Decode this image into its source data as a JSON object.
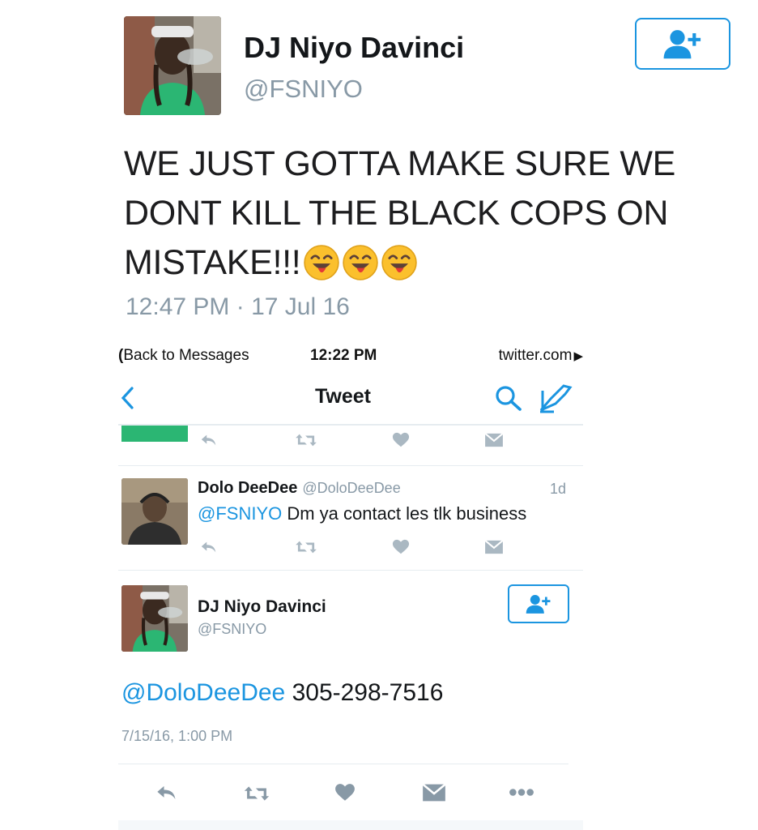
{
  "main_tweet": {
    "name": "DJ Niyo Davinci",
    "handle": "@FSNIYO",
    "text": "WE JUST GOTTA MAKE SURE WE DONT KILL THE BLACK COPS ON MISTAKE!!!",
    "emoji": "winking-face-with-tongue",
    "emoji_count": 3,
    "timestamp": "12:47 PM · 17 Jul 16"
  },
  "status_bar": {
    "back": "Back to Messages",
    "time": "12:22 PM",
    "site": "twitter.com"
  },
  "nav": {
    "title": "Tweet"
  },
  "reply": {
    "name": "Dolo DeeDee",
    "handle": "@DoloDeeDee",
    "time": "1d",
    "mention": "@FSNIYO",
    "text": "Dm ya contact les tlk business"
  },
  "detail_tweet": {
    "name": "DJ Niyo Davinci",
    "handle": "@FSNIYO",
    "mention": "@DoloDeeDee",
    "text": "305-298-7516",
    "timestamp": "7/15/16, 1:00 PM"
  },
  "colors": {
    "accent": "#1b95e0",
    "muted": "#8899a6",
    "icon": "#aab8c2"
  }
}
